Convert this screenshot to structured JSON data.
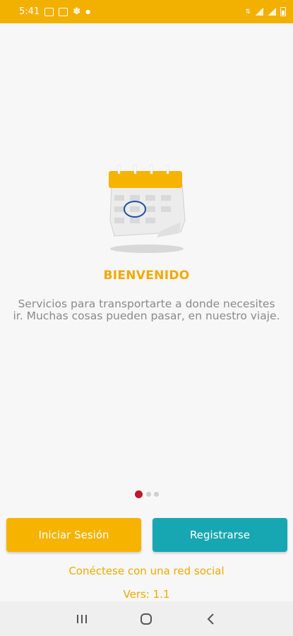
{
  "status_bar": {
    "time": "5:41",
    "icons": [
      "gallery-icon",
      "image-icon",
      "sync-icon",
      "dot-icon"
    ],
    "right_icons": [
      "lte-icon",
      "signal-icon",
      "signal-icon",
      "battery-icon"
    ],
    "background": "#f2b000"
  },
  "onboarding": {
    "title": "BIENVENIDO",
    "description": "Servicios para transportarte a donde necesites ir. Muchas cosas pueden pasar, en nuestro viaje.",
    "illustration": "calendar-icon",
    "page_indicator": {
      "total": 3,
      "current": 1
    }
  },
  "buttons": {
    "login_label": "Iniciar Sesión",
    "register_label": "Registrarse"
  },
  "links": {
    "social": "Conéctese con una red social",
    "version": "Vers: 1.1"
  },
  "colors": {
    "accent": "#f2a900",
    "login_button": "#f6b300",
    "register_button": "#17a7b3",
    "active_dot": "#c0172b"
  },
  "nav_bar": {
    "items": [
      "recent-apps-icon",
      "home-icon",
      "back-icon"
    ]
  }
}
